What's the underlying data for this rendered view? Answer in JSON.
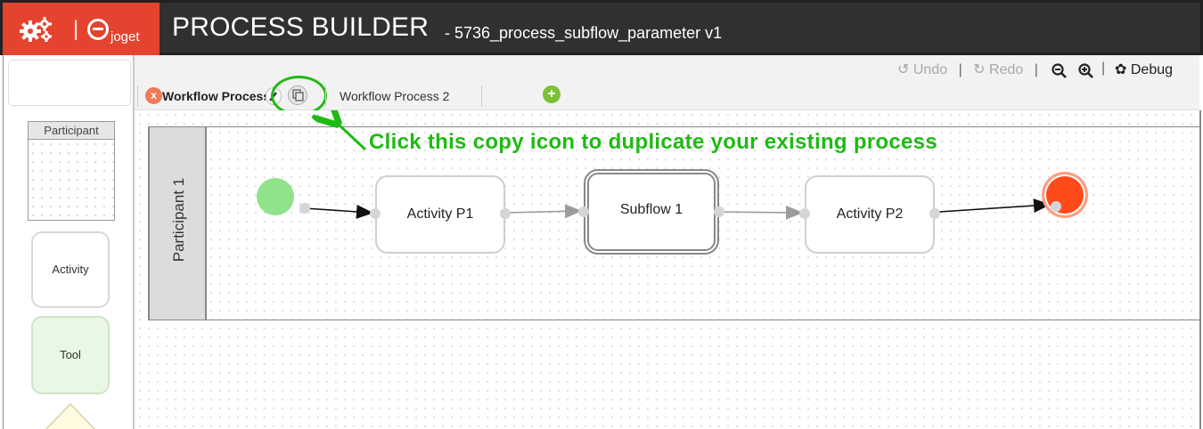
{
  "header": {
    "app_brand": "joget",
    "title": "PROCESS BUILDER",
    "subtitle": "- 5736_process_subflow_parameter v1"
  },
  "toolbar": {
    "undo_label": "Undo",
    "redo_label": "Redo",
    "separator": "|",
    "debug_label": "Debug"
  },
  "tabs": {
    "active_label": "Workflow Process 1",
    "second_label": "Workflow Process 2",
    "close_glyph": "x",
    "add_glyph": "+"
  },
  "palette": {
    "participant_label": "Participant",
    "activity_label": "Activity",
    "tool_label": "Tool"
  },
  "diagram": {
    "lane_label": "Participant 1",
    "nodes": [
      {
        "type": "activity",
        "label": "Activity P1"
      },
      {
        "type": "subflow",
        "label": "Subflow 1"
      },
      {
        "type": "activity",
        "label": "Activity P2"
      }
    ]
  },
  "annotation": {
    "text": "Click this copy icon to duplicate your existing process",
    "color": "#1fba13"
  },
  "colors": {
    "brand": "#e4442f",
    "header_bg": "#303030",
    "start_event": "#90e38a",
    "end_event": "#ff4a1a",
    "tool_bg": "#e9f8e4"
  },
  "icons": [
    "gear-logo-icon",
    "joget-logo-icon",
    "undo-icon",
    "redo-icon",
    "zoom-out-icon",
    "zoom-in-icon",
    "gear-icon",
    "close-icon",
    "pencil-icon",
    "copy-icon",
    "plus-icon"
  ]
}
